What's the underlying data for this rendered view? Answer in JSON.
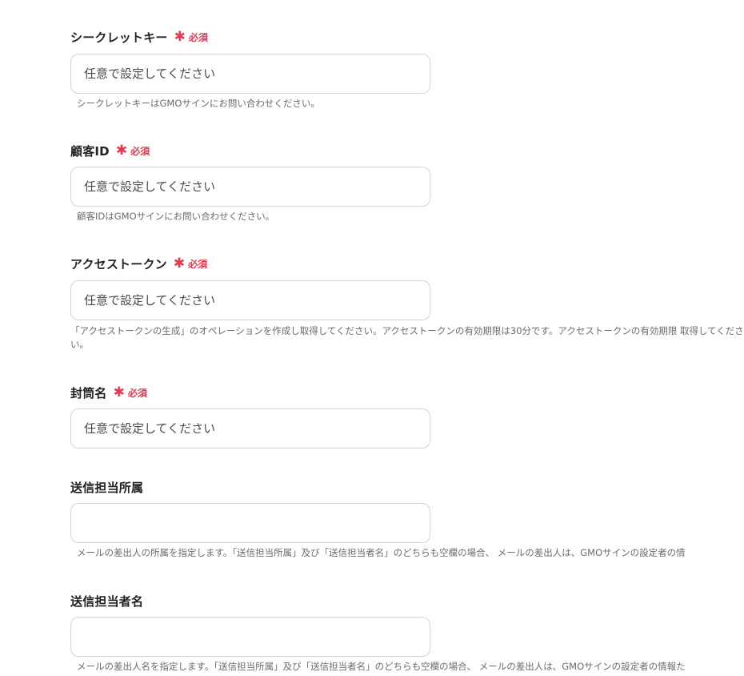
{
  "fields": [
    {
      "label": "シークレットキー",
      "required": true,
      "required_mark": "✱",
      "required_text": "必須",
      "placeholder": "任意で設定してください",
      "value": "",
      "help": "シークレットキーはGMOサインにお問い合わせください。"
    },
    {
      "label": "顧客ID",
      "required": true,
      "required_mark": "✱",
      "required_text": "必須",
      "placeholder": "任意で設定してください",
      "value": "",
      "help": "顧客IDはGMOサインにお問い合わせください。"
    },
    {
      "label": "アクセストークン",
      "required": true,
      "required_mark": "✱",
      "required_text": "必須",
      "placeholder": "任意で設定してください",
      "value": "",
      "help": "「アクセストークンの生成」のオペレーションを作成し取得してください。アクセストークンの有効期限は30分です。アクセストークンの有効期限 取得してください。"
    },
    {
      "label": "封筒名",
      "required": true,
      "required_mark": "✱",
      "required_text": "必須",
      "placeholder": "任意で設定してください",
      "value": "",
      "help": ""
    },
    {
      "label": "送信担当所属",
      "required": false,
      "placeholder": "",
      "value": "",
      "help": "メールの差出人の所属を指定します。「送信担当所属」及び「送信担当者名」のどちらも空欄の場合、 メールの差出人は、GMOサインの設定者の情"
    },
    {
      "label": "送信担当者名",
      "required": false,
      "placeholder": "",
      "value": "",
      "help": "メールの差出人名を指定します。「送信担当所属」及び「送信担当者名」のどちらも空欄の場合、 メールの差出人は、GMOサインの設定者の情報た"
    }
  ],
  "colors": {
    "required": "#e8384f",
    "border": "#d4d4d4",
    "help_text": "#6b6b6b"
  }
}
